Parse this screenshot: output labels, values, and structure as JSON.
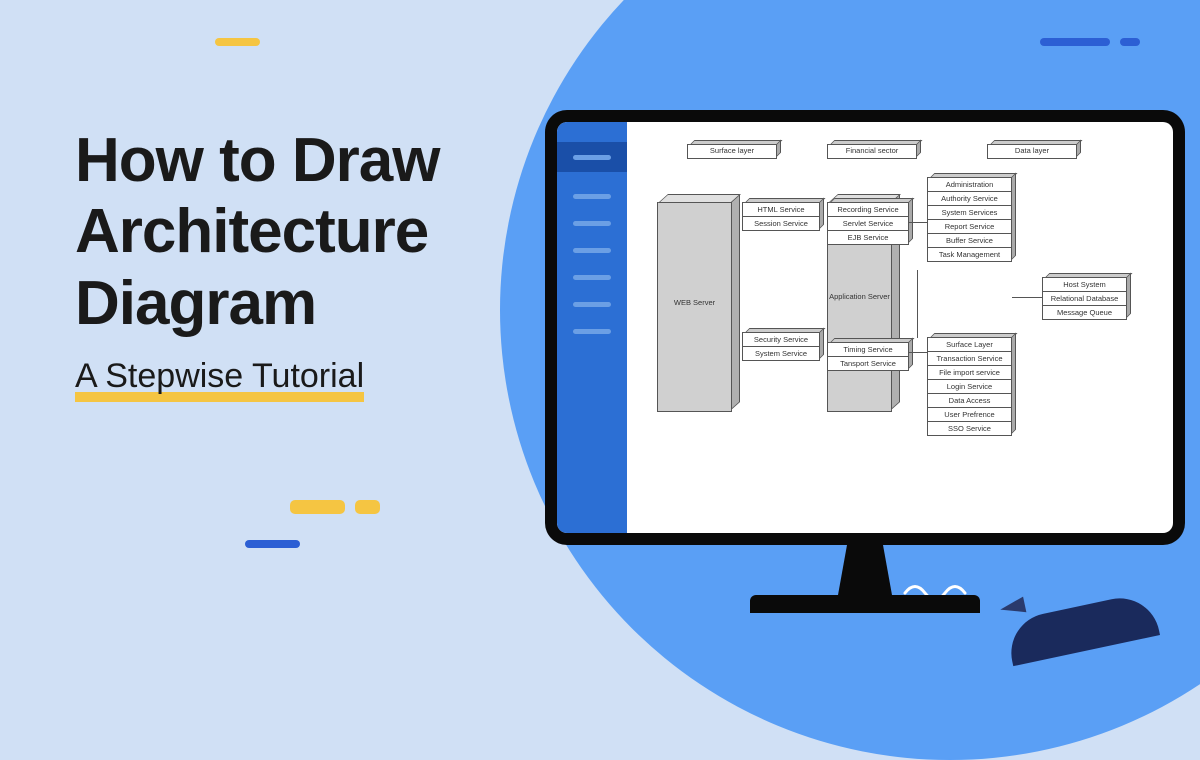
{
  "title": {
    "line1": "How to Draw",
    "line2": "Architecture",
    "line3": "Diagram",
    "subtitle": "A Stepwise Tutorial"
  },
  "diagram": {
    "top_layers": [
      "Surface layer",
      "Financial sector",
      "Data layer"
    ],
    "web_server": "WEB Server",
    "app_server": "Application Server",
    "col1_top": [
      "HTML Service",
      "Session Service"
    ],
    "col1_bot": [
      "Security Service",
      "System Service"
    ],
    "col2_top": [
      "Recording Service",
      "Servlet Service",
      "EJB Service"
    ],
    "col2_bot": [
      "Timing Service",
      "Tansport Service"
    ],
    "col3_top": [
      "Administration",
      "Authority Service",
      "System Services",
      "Report Service",
      "Buffer Service",
      "Task Management"
    ],
    "col3_bot": [
      "Surface Layer",
      "Transaction Service",
      "File import service",
      "Login Service",
      "Data Access",
      "User Prefrence",
      "SSO Service"
    ],
    "col4": [
      "Host System",
      "Relational Database",
      "Message Queue"
    ]
  }
}
